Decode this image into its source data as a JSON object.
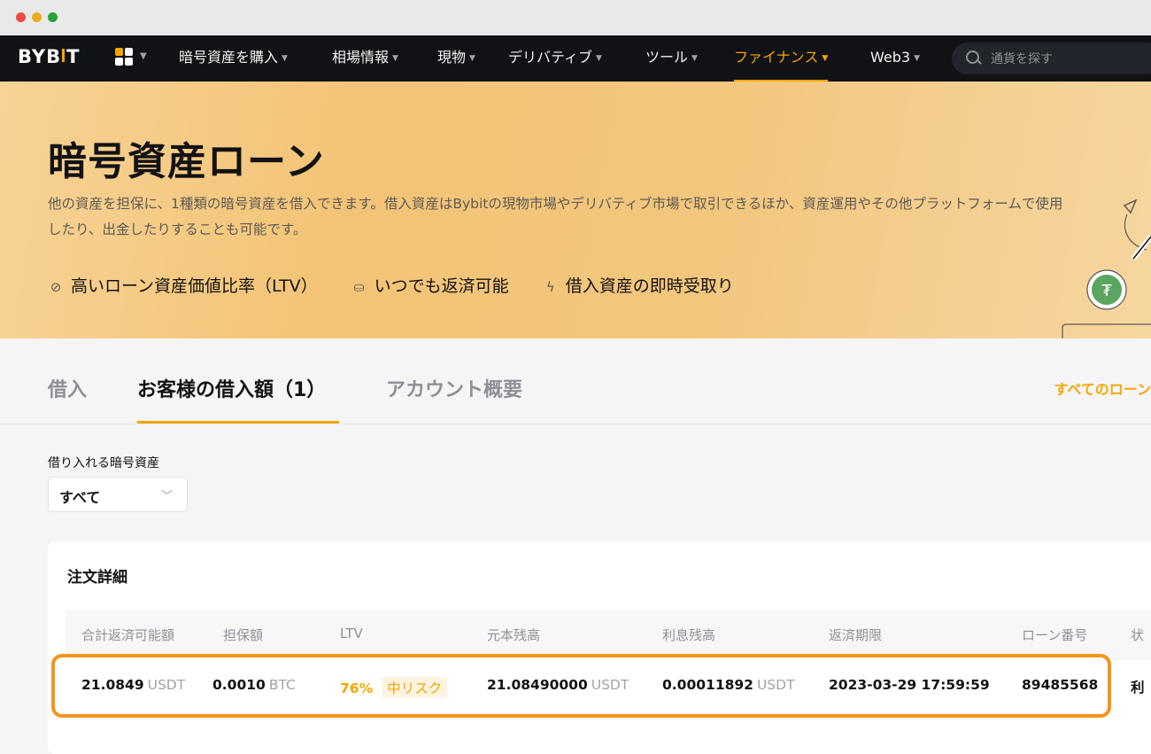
{
  "nav": {
    "logo": "BYBIT",
    "items": [
      {
        "label": "暗号資産を購入",
        "active": false
      },
      {
        "label": "相場情報",
        "active": false
      },
      {
        "label": "現物",
        "active": false
      },
      {
        "label": "デリバティブ",
        "active": false
      },
      {
        "label": "ツール",
        "active": false
      },
      {
        "label": "ファイナンス",
        "active": true
      },
      {
        "label": "Web3",
        "active": false
      }
    ],
    "search_placeholder": "通貨を探す"
  },
  "hero": {
    "title": "暗号資産ローン",
    "description": "他の資産を担保に、1種類の暗号資産を借入できます。借入資産はBybitの現物市場やデリバティブ市場で取引できるほか、資産運用やその他プラットフォームで使用したり、出金したりすることも可能です。",
    "features": [
      {
        "icon": "check-circle-icon",
        "label": "高いローン資産価値比率（LTV）"
      },
      {
        "icon": "repay-icon",
        "label": "いつでも返済可能"
      },
      {
        "icon": "lightning-icon",
        "label": "借入資産の即時受取り"
      }
    ]
  },
  "tabs": [
    {
      "label": "借入",
      "active": false
    },
    {
      "label": "お客様の借入額（1）",
      "active": true
    },
    {
      "label": "アカウント概要",
      "active": false
    }
  ],
  "all_loans_link": "すべてのローン",
  "filter": {
    "label": "借り入れる暗号資産",
    "value": "すべて"
  },
  "order": {
    "title": "注文詳細",
    "columns": [
      "合計返済可能額",
      "担保額",
      "LTV",
      "元本残高",
      "利息残高",
      "返済期限",
      "ローン番号",
      "状"
    ],
    "row": {
      "total_repayable": "21.0849",
      "total_repayable_unit": "USDT",
      "collateral": "0.0010",
      "collateral_unit": "BTC",
      "ltv": "76%",
      "risk": "中リスク",
      "principal": "21.08490000",
      "principal_unit": "USDT",
      "interest": "0.00011892",
      "interest_unit": "USDT",
      "due": "2023-03-29 17:59:59",
      "loan_no": "89485568",
      "status": "利"
    }
  },
  "colors": {
    "accent": "#f7a600",
    "highlight_border": "#f2961c",
    "navbar": "#101216"
  }
}
